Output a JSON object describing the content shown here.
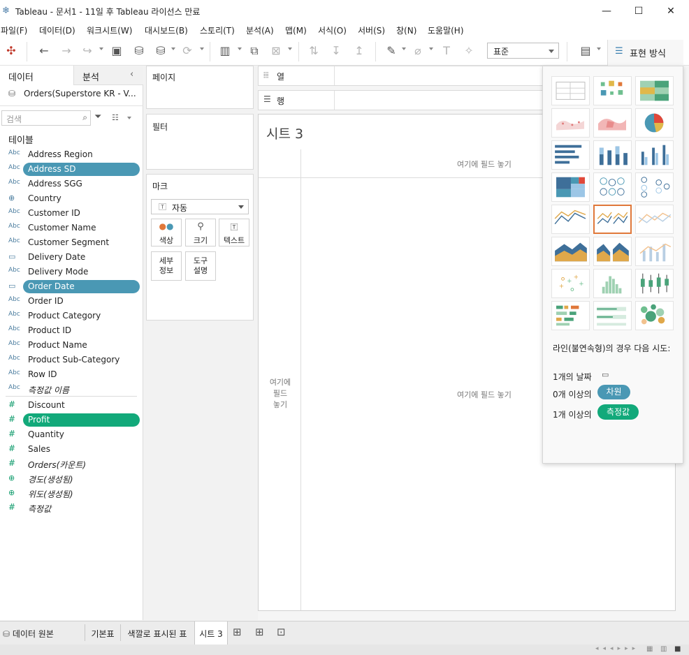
{
  "window": {
    "title": "Tableau - 문서1 - 11일 후 Tableau 라이선스 만료"
  },
  "menu": [
    "파일(F)",
    "데이터(D)",
    "워크시트(W)",
    "대시보드(B)",
    "스토리(T)",
    "분석(A)",
    "맵(M)",
    "서식(O)",
    "서버(S)",
    "창(N)",
    "도움말(H)"
  ],
  "toolbar": {
    "fit_value": "표준",
    "show_me_label": "표현 방식"
  },
  "data_pane": {
    "tabs": [
      "데이터",
      "분석"
    ],
    "datasource": "Orders(Superstore KR - V...",
    "search_placeholder": "검색",
    "tables_heading": "테이블",
    "dimensions": [
      {
        "icon": "Abc",
        "name": "Address Region"
      },
      {
        "icon": "Abc",
        "name": "Address SD",
        "highlight": "#4a98b4"
      },
      {
        "icon": "Abc",
        "name": "Address SGG"
      },
      {
        "icon": "globe-icon",
        "name": "Country"
      },
      {
        "icon": "Abc",
        "name": "Customer ID"
      },
      {
        "icon": "Abc",
        "name": "Customer Name"
      },
      {
        "icon": "Abc",
        "name": "Customer Segment"
      },
      {
        "icon": "calendar-icon",
        "name": "Delivery Date"
      },
      {
        "icon": "Abc",
        "name": "Delivery Mode"
      },
      {
        "icon": "calendar-icon",
        "name": "Order Date",
        "highlight": "#4a98b4"
      },
      {
        "icon": "Abc",
        "name": "Order ID"
      },
      {
        "icon": "Abc",
        "name": "Product Category"
      },
      {
        "icon": "Abc",
        "name": "Product ID"
      },
      {
        "icon": "Abc",
        "name": "Product Name"
      },
      {
        "icon": "Abc",
        "name": "Product Sub-Category"
      },
      {
        "icon": "Abc",
        "name": "Row ID"
      },
      {
        "icon": "Abc",
        "name": "측정값 이름",
        "italic": true
      }
    ],
    "measures": [
      {
        "icon": "#",
        "name": "Discount"
      },
      {
        "icon": "#",
        "name": "Profit",
        "highlight": "#12a97a"
      },
      {
        "icon": "#",
        "name": "Quantity"
      },
      {
        "icon": "#",
        "name": "Sales"
      },
      {
        "icon": "#",
        "name": "Orders(카운트)",
        "italic": true
      },
      {
        "icon": "globe-icon",
        "name": "경도(생성됨)",
        "italic": true
      },
      {
        "icon": "globe-icon",
        "name": "위도(생성됨)",
        "italic": true
      },
      {
        "icon": "#",
        "name": "측정값",
        "italic": true
      }
    ]
  },
  "shelves": {
    "pages": "페이지",
    "filters": "필터",
    "marks": "마크",
    "mark_type": "자동",
    "mark_buttons": [
      "색상",
      "크기",
      "텍스트",
      "세부\n정보",
      "도구\n설명"
    ],
    "columns": "열",
    "rows": "행"
  },
  "view": {
    "sheet_title": "시트 3",
    "drop_top": "여기에 필드 놓기",
    "drop_center": "여기에 필드 놓기",
    "drop_left": "여기에\n필드\n놓기"
  },
  "show_me": {
    "hint_title": "라인(불연속형)의 경우 다음 시도:",
    "req_date": "1개의 날짜",
    "req_dim_prefix": "0개 이상의",
    "req_dim_pill": "차원",
    "req_meas_prefix": "1개 이상의",
    "req_meas_pill": "측정값",
    "colors": {
      "dimension": "#4a98b4",
      "measure": "#12a97a",
      "selected": "#e0783a"
    }
  },
  "bottom_tabs": [
    "데이터 원본",
    "기본표",
    "색깔로 표시된 표",
    "시트 3"
  ]
}
